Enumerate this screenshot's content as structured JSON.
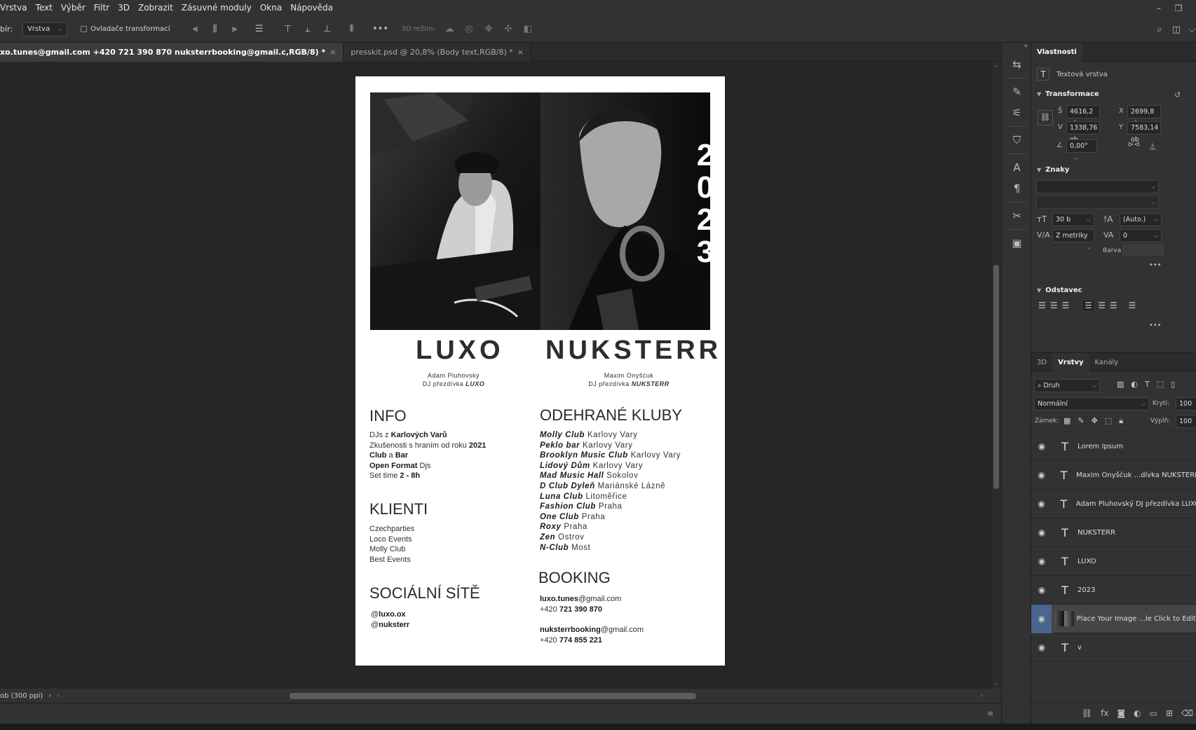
{
  "menu": [
    "Vrstva",
    "Text",
    "Výběr",
    "Filtr",
    "3D",
    "Zobrazit",
    "Zásuvné moduly",
    "Okna",
    "Nápověda"
  ],
  "options": {
    "select_label": "bír:",
    "select_value": "Vrstva",
    "transform_controls": "Ovladače transformací",
    "mode_3d": "3D režim:"
  },
  "tabs": [
    {
      "label": "xo.tunes@gmail.com  +420 721 390 870  nuksterrbooking@gmail.c,RGB/8) *",
      "active": true
    },
    {
      "label": "presskit.psd @ 20,8% (Body text,RGB/8) *",
      "active": false
    }
  ],
  "status": {
    "zoom": "ob (300 ppi)"
  },
  "doc": {
    "year_digits": [
      "2",
      "0",
      "2",
      "3"
    ],
    "name_left": "LUXO",
    "name_right": "NUKSTERR",
    "sub_left_1": "Adam Pluhovský",
    "sub_left_2": "DJ přezdívka",
    "sub_left_nick": "LUXO",
    "sub_right_1": "Maxim Onyšćuk",
    "sub_right_2": "DJ přezdívka",
    "sub_right_nick": "NUKSTERR",
    "info_title": "INFO",
    "info_lines": [
      {
        "plain": "DJs z ",
        "bold": "Karlových Varů",
        "rest": ""
      },
      {
        "plain": "Zkušenosti s hraním od roku ",
        "bold": "2021",
        "rest": ""
      },
      {
        "plain": "",
        "bold": "Club",
        "rest": " a ",
        "bold2": "Bar"
      },
      {
        "plain": "",
        "bold": "Open Format",
        "rest": " Djs"
      },
      {
        "plain": "Set time ",
        "bold": "2 - 8h",
        "rest": ""
      }
    ],
    "clients_title": "KLIENTI",
    "clients": [
      "Czechparties",
      "Loco Events",
      "Molly Club",
      "Best Events"
    ],
    "social_title": "SOCIÁLNÍ SÍTĚ",
    "social": [
      {
        "at": "@",
        "handle": "luxo.ox"
      },
      {
        "at": "@",
        "handle": "nuksterr"
      }
    ],
    "clubs_title": "ODEHRANÉ KLUBY",
    "clubs": [
      {
        "name": "Molly Club",
        "city": "Karlovy Vary"
      },
      {
        "name": "Peklo bar",
        "city": "Karlovy Vary"
      },
      {
        "name": "Brooklyn Music Club",
        "city": "Karlovy Vary"
      },
      {
        "name": "Lidový Dům",
        "city": "Karlovy Vary"
      },
      {
        "name": "Mad Music Hall",
        "city": "Sokolov"
      },
      {
        "name": "D Club Dyleň",
        "city": "Mariánské Lázně"
      },
      {
        "name": "Luna Club",
        "city": "Litoměřice"
      },
      {
        "name": "Fashion Club",
        "city": "Praha"
      },
      {
        "name": "One Club",
        "city": "Praha"
      },
      {
        "name": "Roxy",
        "city": "Praha"
      },
      {
        "name": "Zen",
        "city": "Ostrov"
      },
      {
        "name": "N-Club",
        "city": "Most"
      }
    ],
    "booking_title": "BOOKING",
    "booking_email1_user": "luxo.tunes",
    "booking_email1_domain": "@gmail.com",
    "booking_phone1_prefix": "+420 ",
    "booking_phone1": "721 390 870",
    "booking_email2_user": "nuksterrbooking",
    "booking_email2_domain": "@gmail.com",
    "booking_phone2_prefix": "+420 ",
    "booking_phone2": "774 855 221"
  },
  "properties": {
    "tab": "Vlastnosti",
    "layer_kind": "Textová vrstva",
    "transform_title": "Transformace",
    "w_label": "Š",
    "w_value": "4616,2 ob",
    "x_label": "X",
    "x_value": "2699,8 ob",
    "h_label": "V",
    "h_value": "1338,76 ob",
    "y_label": "Y",
    "y_value": "7583,14 ob",
    "angle_value": "0,00°",
    "chars_title": "Znaky",
    "font_size": "30 b",
    "leading": "(Auto.)",
    "kerning": "Z metriky",
    "tracking": "0",
    "color_label": "Barva",
    "para_title": "Odstavec"
  },
  "layers_panel": {
    "tabs": [
      "3D",
      "Vrstvy",
      "Kanály"
    ],
    "active_tab": "Vrstvy",
    "filter": "Druh",
    "blend": "Normální",
    "opacity_label": "Krytí:",
    "opacity_value": "100",
    "lock_label": "Zámek:",
    "fill_label": "Výplň:",
    "fill_value": "100",
    "layers": [
      {
        "name": "Lorem Ipsum",
        "type": "text",
        "selected": false
      },
      {
        "name": "Maxim Onyšćuk ...dívka NUKSTERR",
        "type": "text",
        "selected": false
      },
      {
        "name": "Adam Pluhovský  DJ přezdívka LUXO",
        "type": "text",
        "selected": false
      },
      {
        "name": "NUKSTERR",
        "type": "text",
        "selected": false
      },
      {
        "name": "LUXO",
        "type": "text",
        "selected": false
      },
      {
        "name": "2023",
        "type": "text",
        "selected": false
      },
      {
        "name": "Place Your Image ...le Click to Edit)",
        "type": "smart",
        "selected": true
      },
      {
        "name": "v",
        "type": "text",
        "selected": false
      }
    ]
  }
}
